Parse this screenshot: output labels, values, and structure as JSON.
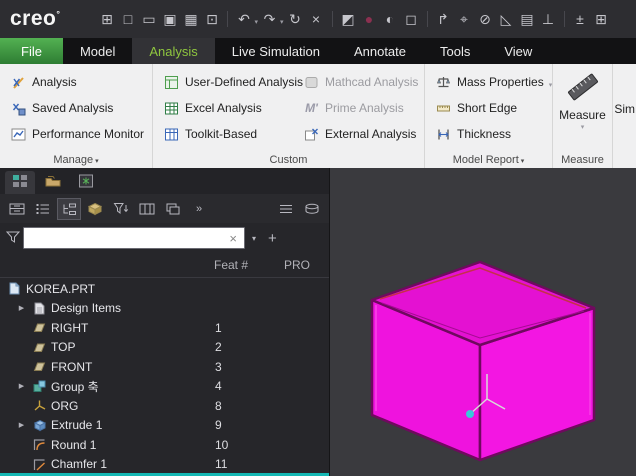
{
  "glyphs": {
    "dropdown": "▾",
    "overflow": "»",
    "clear": "×",
    "add": "+",
    "expand": "▶"
  },
  "titlebar": {
    "logo": "creo",
    "logo_mark": "°",
    "icons": [
      {
        "name": "sketch-icon",
        "glyph": "⊞"
      },
      {
        "name": "new-file-icon",
        "glyph": "□"
      },
      {
        "name": "open-file-icon",
        "glyph": "▭"
      },
      {
        "name": "save-icon",
        "glyph": "▣"
      },
      {
        "name": "print-icon",
        "glyph": "▦"
      },
      {
        "name": "import-icon",
        "glyph": "⊡"
      },
      {
        "name": "undo-icon",
        "glyph": "↶"
      },
      {
        "name": "redo-icon",
        "glyph": "↷"
      },
      {
        "name": "regenerate-icon",
        "glyph": "↻"
      },
      {
        "name": "close-window-icon",
        "glyph": "×"
      },
      {
        "name": "appearance-icon",
        "glyph": "◩"
      },
      {
        "name": "render-sphere-icon",
        "glyph": "●"
      },
      {
        "name": "shade-sphere-icon",
        "glyph": "◐"
      },
      {
        "name": "display-style-icon",
        "glyph": "◻"
      },
      {
        "name": "saved-views-icon",
        "glyph": "↱"
      },
      {
        "name": "view-normal-icon",
        "glyph": "⌖"
      },
      {
        "name": "hidden-line-icon",
        "glyph": "⊘"
      },
      {
        "name": "perspective-icon",
        "glyph": "◺"
      },
      {
        "name": "annotation-icon",
        "glyph": "▤"
      },
      {
        "name": "ground-icon",
        "glyph": "⊥"
      },
      {
        "name": "plus-minus-icon",
        "glyph": "±"
      },
      {
        "name": "window-grid-icon",
        "glyph": "⊞"
      }
    ]
  },
  "tabs": {
    "items": [
      {
        "label": "File"
      },
      {
        "label": "Model"
      },
      {
        "label": "Analysis"
      },
      {
        "label": "Live Simulation"
      },
      {
        "label": "Annotate"
      },
      {
        "label": "Tools"
      },
      {
        "label": "View"
      }
    ]
  },
  "ribbon": {
    "manage": {
      "label": "Manage",
      "items": [
        "Analysis",
        "Saved Analysis",
        "Performance Monitor"
      ]
    },
    "custom": {
      "label": "Custom",
      "col1": [
        "User-Defined Analysis",
        "Excel Analysis",
        "Toolkit-Based"
      ],
      "col2": [
        "Mathcad Analysis",
        "Prime Analysis",
        "External Analysis"
      ]
    },
    "model_report": {
      "label": "Model Report",
      "items": [
        "Mass Properties",
        "Short Edge",
        "Thickness"
      ]
    },
    "measure": {
      "label": "Measure",
      "button": "Measure"
    },
    "partial_next": "Sim",
    "prime_glyph": "M'"
  },
  "panel": {
    "filter": {
      "value": ""
    },
    "columns": {
      "feat": "Feat #",
      "pro": "PRO"
    },
    "tree": [
      {
        "label": "KOREA.PRT",
        "feat": ""
      },
      {
        "label": "Design Items",
        "feat": ""
      },
      {
        "label": "RIGHT",
        "feat": "1"
      },
      {
        "label": "TOP",
        "feat": "2"
      },
      {
        "label": "FRONT",
        "feat": "3"
      },
      {
        "label": "Group 축",
        "feat": "4"
      },
      {
        "label": "ORG",
        "feat": "8"
      },
      {
        "label": "Extrude 1",
        "feat": "9"
      },
      {
        "label": "Round 1",
        "feat": "10"
      },
      {
        "label": "Chamfer 1",
        "feat": "11"
      }
    ]
  },
  "colors": {
    "accent_green": "#8fc63f",
    "file_tab_green": "#3f9c35",
    "model_magenta": "#ef13de",
    "viewport_bg": "#3a3a3e",
    "teal_highlight": "#14b8b4"
  }
}
